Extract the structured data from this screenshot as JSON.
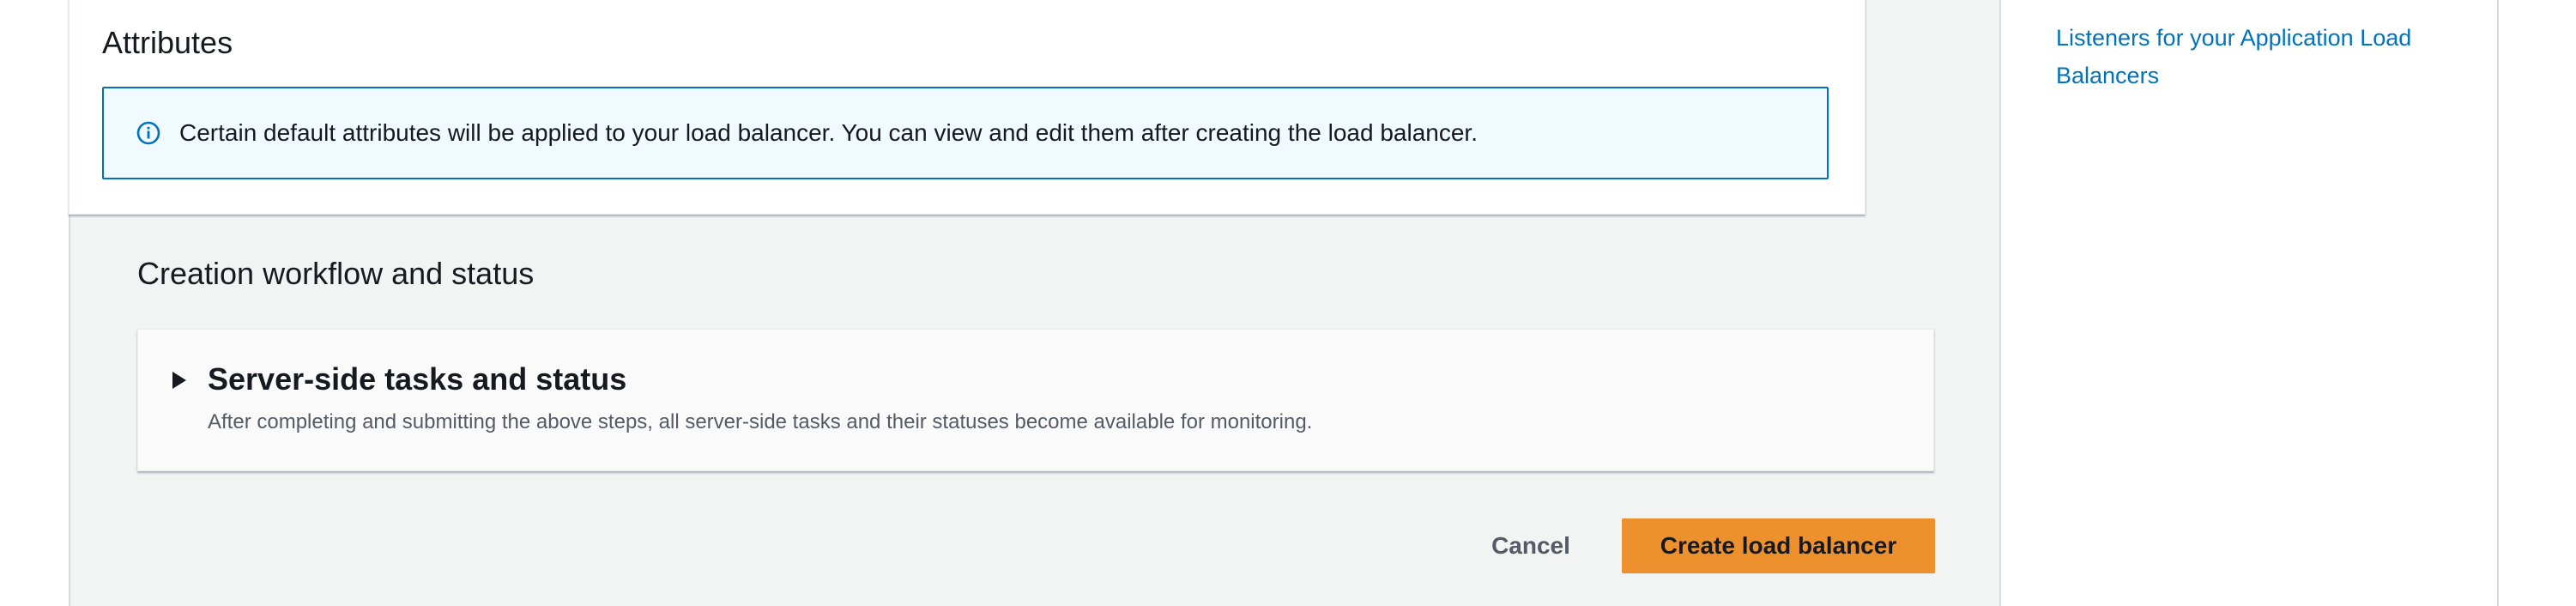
{
  "attributes": {
    "title": "Attributes",
    "alert_text": "Certain default attributes will be applied to your load balancer. You can view and edit them after creating the load balancer."
  },
  "creation_workflow": {
    "heading": "Creation workflow and status",
    "tasks_title": "Server-side tasks and status",
    "tasks_description": "After completing and submitting the above steps, all server-side tasks and their statuses become available for monitoring."
  },
  "actions": {
    "cancel_label": "Cancel",
    "create_label": "Create load balancer"
  },
  "help_panel": {
    "link_text": "Listeners for your Application Load Balancers"
  },
  "colors": {
    "link": "#0073bb",
    "primary_button": "#ec912d",
    "info_border": "#0073bb",
    "info_background": "#f1faff",
    "page_background": "#f2f3f3"
  },
  "icons": {
    "alert_icon": "info-icon",
    "expander_icon": "caret-right-icon"
  }
}
